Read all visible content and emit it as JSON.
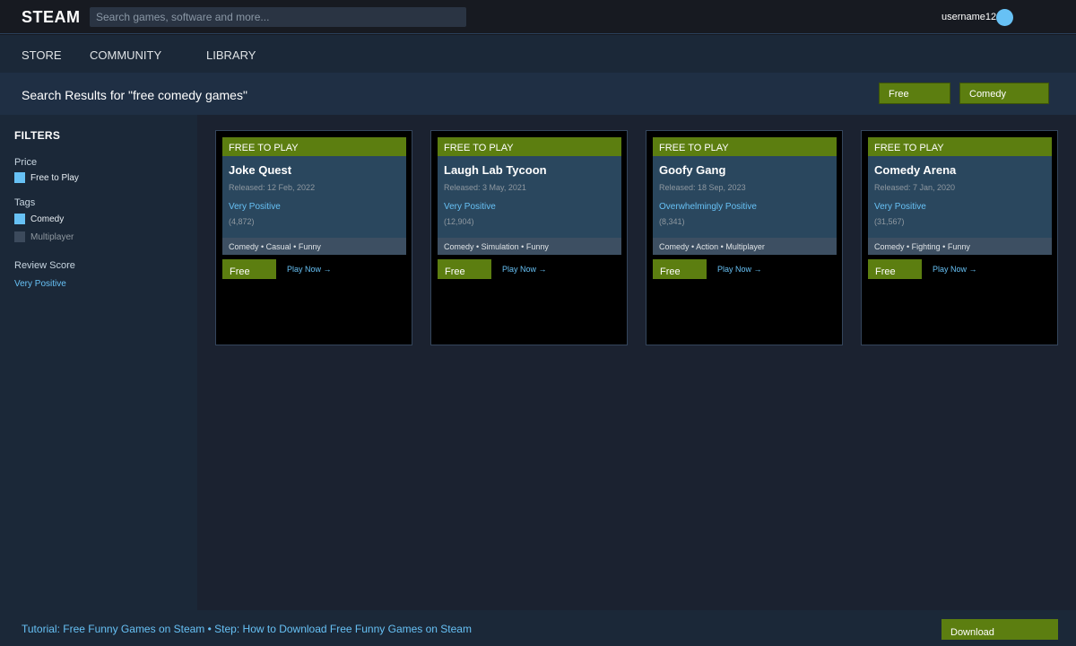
{
  "header": {
    "logo": "STEAM",
    "search_placeholder": "Search games, software and more...",
    "username": "username12"
  },
  "nav": {
    "items": [
      "STORE",
      "COMMUNITY",
      "LIBRARY"
    ]
  },
  "results": {
    "title": "Search Results for \"free comedy games\"",
    "chips": [
      "Free",
      "Comedy"
    ]
  },
  "sidebar": {
    "title": "FILTERS",
    "price_label": "Price",
    "price_options": [
      {
        "label": "Free to Play",
        "checked": true
      }
    ],
    "tags_label": "Tags",
    "tag_options": [
      {
        "label": "Comedy",
        "checked": true
      },
      {
        "label": "Multiplayer",
        "checked": false
      }
    ],
    "review_label": "Review Score",
    "review_value": "Very Positive"
  },
  "games": [
    {
      "badge": "FREE TO PLAY",
      "title": "Joke Quest",
      "released": "Released: 12 Feb, 2022",
      "review": "Very Positive",
      "review_count": "(4,872)",
      "tags": "Comedy • Casual • Funny",
      "price": "Free",
      "action": "Play Now →"
    },
    {
      "badge": "FREE TO PLAY",
      "title": "Laugh Lab Tycoon",
      "released": "Released: 3 May, 2021",
      "review": "Very Positive",
      "review_count": "(12,904)",
      "tags": "Comedy • Simulation • Funny",
      "price": "Free",
      "action": "Play Now →"
    },
    {
      "badge": "FREE TO PLAY",
      "title": "Goofy Gang",
      "released": "Released: 18 Sep, 2023",
      "review": "Overwhelmingly Positive",
      "review_count": "(8,341)",
      "tags": "Comedy • Action • Multiplayer",
      "price": "Free",
      "action": "Play Now →"
    },
    {
      "badge": "FREE TO PLAY",
      "title": "Comedy Arena",
      "released": "Released: 7 Jan, 2020",
      "review": "Very Positive",
      "review_count": "(31,567)",
      "tags": "Comedy • Fighting • Funny",
      "price": "Free",
      "action": "Play Now →"
    }
  ],
  "footer": {
    "text": "Tutorial: Free Funny Games on Steam • Step: How to Download Free Funny Games on Steam",
    "download_label": "Download"
  }
}
